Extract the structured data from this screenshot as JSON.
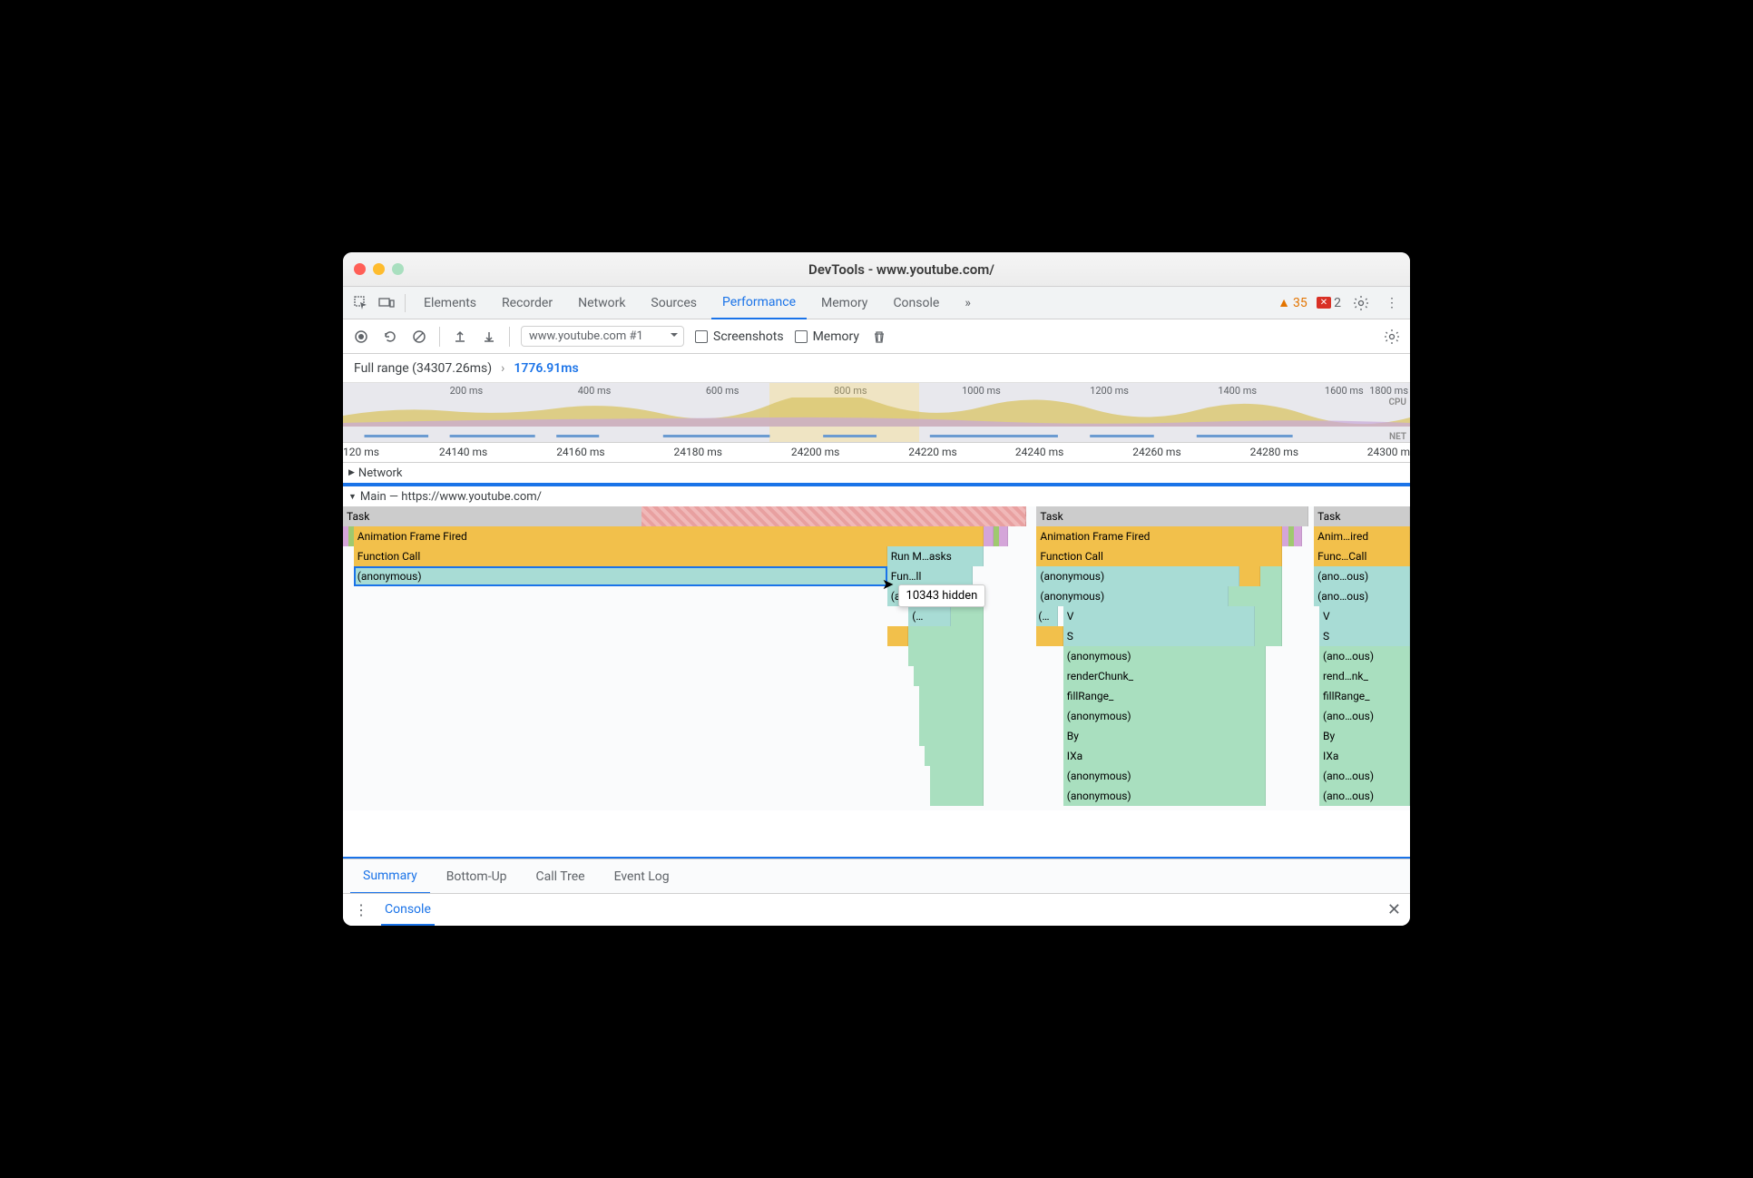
{
  "window": {
    "title": "DevTools - www.youtube.com/"
  },
  "tabs": {
    "items": [
      "Elements",
      "Recorder",
      "Network",
      "Sources",
      "Performance",
      "Memory",
      "Console"
    ],
    "active": "Performance",
    "more": "»",
    "warnings": "35",
    "errors": "2"
  },
  "toolbar": {
    "select": "www.youtube.com #1",
    "screenshots": "Screenshots",
    "memory": "Memory"
  },
  "range": {
    "full": "Full range (34307.26ms)",
    "selected": "1776.91ms"
  },
  "overview": {
    "ticks": [
      "200 ms",
      "400 ms",
      "600 ms",
      "800 ms",
      "1000 ms",
      "1200 ms",
      "1400 ms",
      "1600 ms",
      "1800 ms"
    ],
    "cpu_label": "CPU",
    "net_label": "NET"
  },
  "detail_ticks": [
    "120 ms",
    "24140 ms",
    "24160 ms",
    "24180 ms",
    "24200 ms",
    "24220 ms",
    "24240 ms",
    "24260 ms",
    "24280 ms",
    "24300 m"
  ],
  "sections": {
    "network": "Network",
    "main": "Main — https://www.youtube.com/"
  },
  "flame": {
    "task": "Task",
    "afire": "Animation Frame Fired",
    "fcall": "Function Call",
    "anon": "(anonymous)",
    "runm": "Run M…asks",
    "funll": "Fun…ll",
    "ans": "(an…s)",
    "paren": "(…",
    "v": "V",
    "s": "S",
    "renderChunk": "renderChunk_",
    "fillRange": "fillRange_",
    "by": "By",
    "ixa": "IXa",
    "animired": "Anim…ired",
    "funccall": "Func…Call",
    "anoous": "(ano…ous)",
    "rendnk": "rend…nk_",
    "fillRange2": "fillRange_",
    "tooltip": "10343 hidden"
  },
  "bottom_tabs": [
    "Summary",
    "Bottom-Up",
    "Call Tree",
    "Event Log"
  ],
  "drawer": {
    "label": "Console"
  }
}
